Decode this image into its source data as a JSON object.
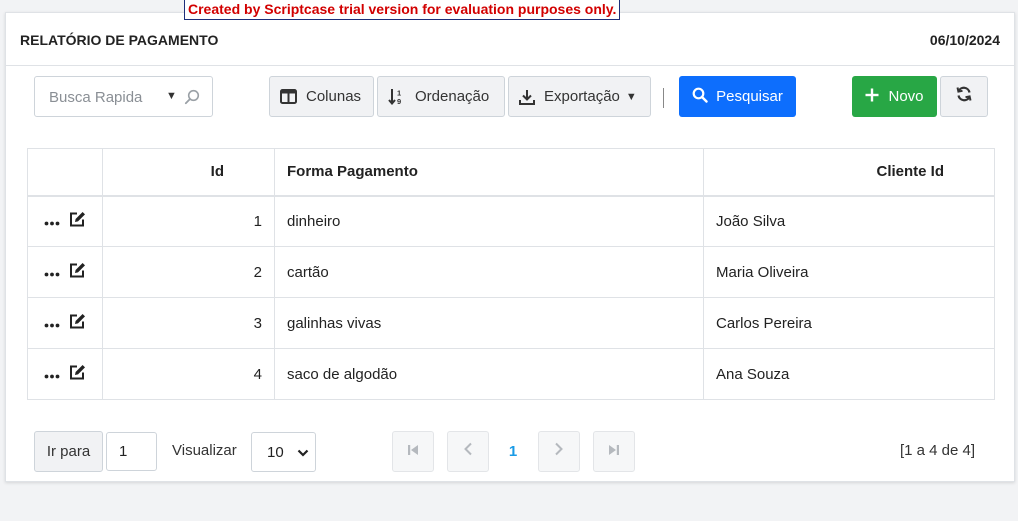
{
  "banner": "Created by Scriptcase trial version for evaluation purposes only.",
  "header": {
    "title": "RELATÓRIO DE PAGAMENTO",
    "date": "06/10/2024"
  },
  "toolbar": {
    "quick_search_placeholder": "Busca Rapida",
    "columns_label": "Colunas",
    "sort_label": "Ordenação",
    "export_label": "Exportação",
    "search_label": "Pesquisar",
    "new_label": "Novo"
  },
  "table": {
    "columns": [
      "",
      "Id",
      "Forma Pagamento",
      "Cliente Id"
    ],
    "rows": [
      {
        "id": "1",
        "forma": "dinheiro",
        "cliente": "João Silva"
      },
      {
        "id": "2",
        "forma": "cartão",
        "cliente": "Maria Oliveira"
      },
      {
        "id": "3",
        "forma": "galinhas vivas",
        "cliente": "Carlos Pereira"
      },
      {
        "id": "4",
        "forma": "saco de algodão",
        "cliente": "Ana Souza"
      }
    ]
  },
  "footer": {
    "goto_label": "Ir para",
    "goto_value": "1",
    "view_label": "Visualizar",
    "page_size": "10",
    "current_page": "1",
    "range_text": "[1 a 4 de 4]"
  },
  "colors": {
    "primary": "#0d6efd",
    "success": "#28a745",
    "active_page": "#1a9be6",
    "banner_text": "#d20000"
  },
  "icons": {
    "columns": "columns-icon",
    "sort": "sort-icon",
    "export": "download-icon",
    "search": "search-icon",
    "new": "plus-icon",
    "refresh": "refresh-icon",
    "row_more": "ellipsis-icon",
    "row_edit": "edit-icon"
  }
}
